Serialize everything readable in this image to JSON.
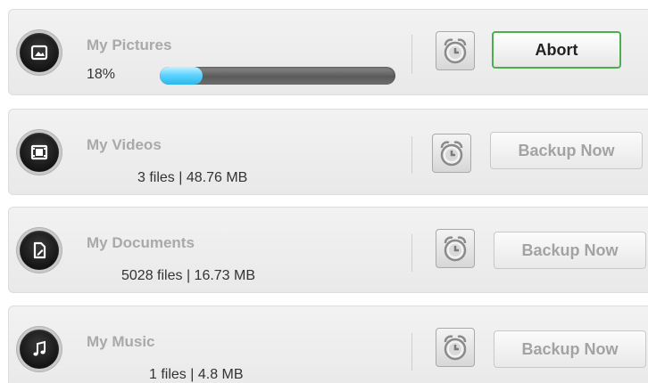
{
  "backup_items": [
    {
      "name": "My Pictures",
      "icon": "picture-icon",
      "percent_label": "18%",
      "progress": 0.18,
      "action_label": "Abort"
    },
    {
      "name": "My Videos",
      "icon": "film-icon",
      "info": "3 files | 48.76 MB",
      "action_label": "Backup Now"
    },
    {
      "name": "My Documents",
      "icon": "document-icon",
      "info": "5028 files | 16.73 MB",
      "action_label": "Backup Now"
    },
    {
      "name": "My Music",
      "icon": "music-note-icon",
      "info": "1 files | 4.8 MB",
      "action_label": "Backup Now"
    }
  ],
  "colors": {
    "progress_fill": "#2cb7ec",
    "active_border": "#4cae4c",
    "muted_text": "#a3a3a3"
  }
}
